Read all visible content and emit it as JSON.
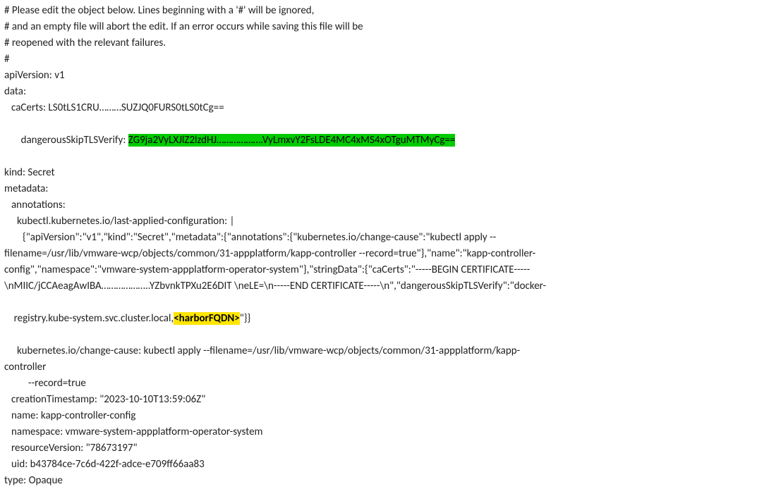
{
  "comment1": "# Please edit the object below. Lines beginning with a '#' will be ignored,",
  "comment2": "# and an empty file will abort the edit. If an error occurs while saving this file will be",
  "comment3": "# reopened with the relevant failures.",
  "comment4": "#",
  "apiVersionLine": "apiVersion: v1",
  "dataLine": "data:",
  "caCertsLine": "caCerts: LS0tLS1CRU………SUZJQ0FURS0tLS0tCg==",
  "skipPrefix": "dangerousSkipTLSVerify: ",
  "skipValue": "ZG9ja2VyLXJlZ2lzdHJ……………….VyLmxvY2FsLDE4MC4xMS4xOTguMTMyCg==",
  "kindLine": "kind: Secret",
  "metadataLine": "metadata:",
  "annotationsLine": "annotations:",
  "lastAppliedLine": "kubectl.kubernetes.io/last-applied-configuration: |",
  "jsonLine1": "{\"apiVersion\":\"v1\",\"kind\":\"Secret\",\"metadata\":{\"annotations\":{\"kubernetes.io/change-cause\":\"kubectl apply --",
  "jsonLine2": "filename=/usr/lib/vmware-wcp/objects/common/31-appplatform/kapp-controller --record=true\"},\"name\":\"kapp-controller-",
  "jsonLine3": "config\",\"namespace\":\"vmware-system-appplatform-operator-system\"},\"stringData\":{\"caCerts\":\"-----BEGIN CERTIFICATE-----",
  "jsonLine4": "\\nMIIC/jCCAeagAwIBA………………..YZbvnkTPXu2E6DIT \\neLE=\\n-----END CERTIFICATE-----\\n\",\"dangerousSkipTLSVerify\":\"docker-",
  "jsonLine5a": "registry.kube-system.svc.cluster.local,",
  "jsonLine5Highlight": "<harborFQDN>",
  "jsonLine5b": "\"}}",
  "changeCauseLine": "kubernetes.io/change-cause: kubectl apply --filename=/usr/lib/vmware-wcp/objects/common/31-appplatform/kapp-",
  "changeCauseLine2": "controller",
  "recordTrueLine": "--record=true",
  "creationTimestampLine": "creationTimestamp: \"2023-10-10T13:59:06Z\"",
  "nameLine": "name: kapp-controller-config",
  "namespaceLine": "namespace: vmware-system-appplatform-operator-system",
  "resourceVersionLine": "resourceVersion: \"78673197\"",
  "uidLine": "uid: b43784ce-7c6d-422f-adce-e709ff66aa83",
  "typeLine": "type: Opaque"
}
